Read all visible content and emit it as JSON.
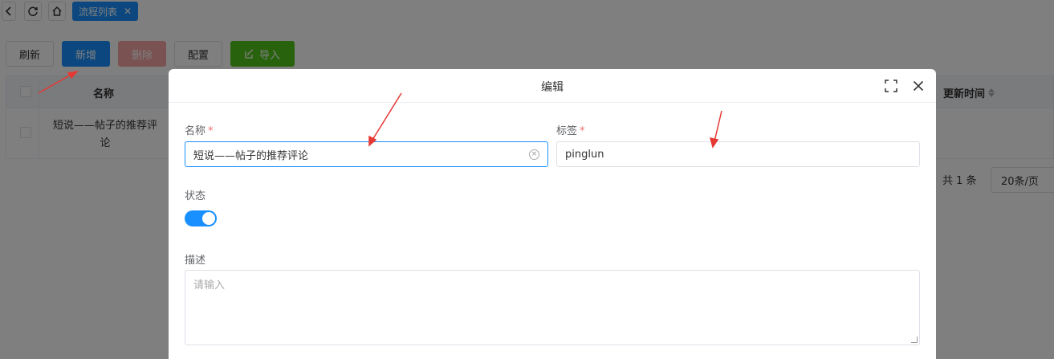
{
  "topbar": {
    "tab_label": "流程列表",
    "tab_close": "✕"
  },
  "toolbar": {
    "refresh": "刷新",
    "add": "新增",
    "delete": "删除",
    "config": "配置",
    "import": "导入"
  },
  "table": {
    "headers": {
      "name": "名称",
      "updated": "更新时间"
    },
    "rows": [
      {
        "name": "短说——帖子的推荐评论"
      }
    ]
  },
  "pager": {
    "total": "共 1 条",
    "page_size": "20条/页"
  },
  "dialog": {
    "title": "编辑",
    "fields": {
      "name": {
        "label": "名称",
        "required_mark": "*",
        "value": "短说——帖子的推荐评论"
      },
      "tag": {
        "label": "标签",
        "required_mark": "*",
        "value": "pinglun"
      },
      "status": {
        "label": "状态",
        "enabled": true
      },
      "description": {
        "label": "描述",
        "placeholder": "请输入"
      }
    }
  },
  "colors": {
    "primary": "#1890ff",
    "danger_disabled": "#f4a5a5",
    "success": "#52c41a",
    "required": "#f56c6c",
    "annotation_arrow": "#e53935"
  }
}
